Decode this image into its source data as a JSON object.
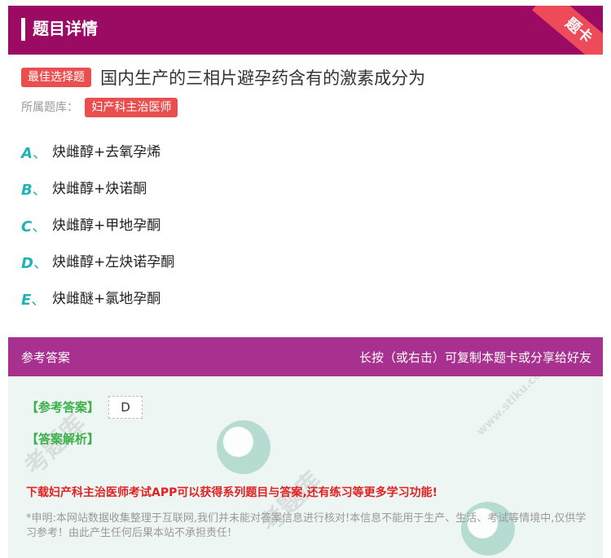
{
  "header": {
    "title": "题目详情",
    "ribbon_label": "题卡"
  },
  "question": {
    "type_badge": "最佳选择题",
    "text": "国内生产的三相片避孕药含有的激素成分为",
    "library_label": "所属题库：",
    "library_badge": "妇产科主治医师"
  },
  "options": [
    {
      "letter": "A",
      "sep": "、",
      "text": "炔雌醇+去氧孕烯"
    },
    {
      "letter": "B",
      "sep": "、",
      "text": "炔雌醇+炔诺酮"
    },
    {
      "letter": "C",
      "sep": "、",
      "text": "炔雌醇+甲地孕酮"
    },
    {
      "letter": "D",
      "sep": "、",
      "text": "炔雌醇+左炔诺孕酮"
    },
    {
      "letter": "E",
      "sep": "、",
      "text": "炔雌醚+氯地孕酮"
    }
  ],
  "answer_section": {
    "title": "参考答案",
    "hint": "长按（或右击）可复制本题卡或分享给好友",
    "answer_label": "【参考答案】",
    "answer_value": "D",
    "analysis_label": "【答案解析】",
    "download_text": "下载妇产科主治医师考试APP可以获得系列题目与答案,还有练习等更多学习功能!",
    "disclaimer": "*申明:本网站数据收集整理于互联网,我们并未能对答案信息进行核对!本信息不能用于生产、生活、考试等情境中,仅供学习参考！由此产生任何后果本站不承担责任!"
  },
  "watermark": "考题库",
  "watermark_url": "www.stiku.com"
}
